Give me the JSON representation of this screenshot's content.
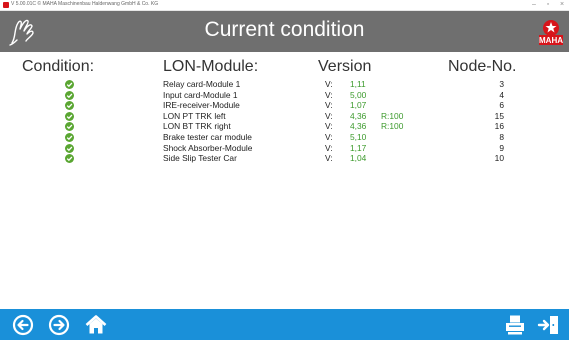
{
  "window": {
    "title": "V 5.00.01C  © MAHA Maschinenbau Haldenwang GmbH & Co. KG"
  },
  "header": {
    "title": "Current condition"
  },
  "columns": {
    "condition": "Condition:",
    "module": "LON-Module:",
    "version": "Version",
    "node": "Node-No."
  },
  "modules": [
    {
      "status": "ok",
      "name": "Relay card-Module 1",
      "vlabel": "V:",
      "version": "1,11",
      "rev": "",
      "node": "3"
    },
    {
      "status": "ok",
      "name": "Input card-Module 1",
      "vlabel": "V:",
      "version": "5,00",
      "rev": "",
      "node": "4"
    },
    {
      "status": "ok",
      "name": "IRE-receiver-Module",
      "vlabel": "V:",
      "version": "1,07",
      "rev": "",
      "node": "6"
    },
    {
      "status": "ok",
      "name": "LON PT TRK left",
      "vlabel": "V:",
      "version": "4,36",
      "rev": "R:100",
      "node": "15"
    },
    {
      "status": "ok",
      "name": "LON BT TRK right",
      "vlabel": "V:",
      "version": "4,36",
      "rev": "R:100",
      "node": "16"
    },
    {
      "status": "ok",
      "name": "Brake tester car module",
      "vlabel": "V:",
      "version": "5,10",
      "rev": "",
      "node": "8"
    },
    {
      "status": "ok",
      "name": "Shock Absorber-Module",
      "vlabel": "V:",
      "version": "1,17",
      "rev": "",
      "node": "9"
    },
    {
      "status": "ok",
      "name": "Side Slip Tester Car",
      "vlabel": "V:",
      "version": "1,04",
      "rev": "",
      "node": "10"
    }
  ],
  "colors": {
    "header_bg": "#6f6f6f",
    "footer_bg": "#1a90d9",
    "status_ok": "#5aa632",
    "version_text": "#3c9a2c",
    "brand_red": "#d7141a"
  },
  "icons": {
    "back": "arrow-left-circle-icon",
    "forward": "arrow-right-circle-icon",
    "home": "home-icon",
    "print": "printer-icon",
    "exit": "exit-door-icon"
  }
}
